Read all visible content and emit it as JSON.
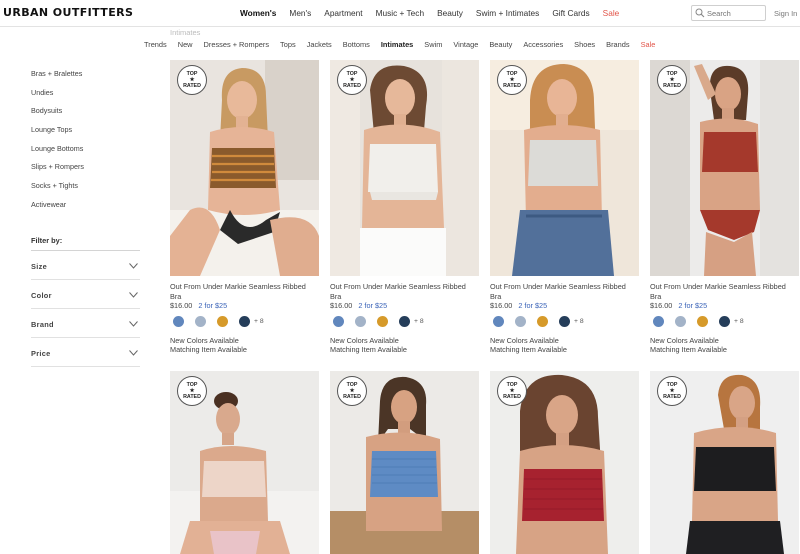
{
  "brand": {
    "logo": "URBAN OUTFITTERS"
  },
  "main_nav": [
    "Women's",
    "Men's",
    "Apartment",
    "Music + Tech",
    "Beauty",
    "Swim + Intimates",
    "Gift Cards",
    "Sale"
  ],
  "search": {
    "placeholder": "Search"
  },
  "account": {
    "signin": "Sign In"
  },
  "breadcrumb_ghost": "Intimates",
  "sub_nav": [
    "Trends",
    "New",
    "Dresses + Rompers",
    "Tops",
    "Jackets",
    "Bottoms",
    "Intimates",
    "Swim",
    "Vintage",
    "Beauty",
    "Accessories",
    "Shoes",
    "Brands",
    "Sale"
  ],
  "sidebar": {
    "categories": [
      "Bras + Bralettes",
      "Undies",
      "Bodysuits",
      "Lounge Tops",
      "Lounge Bottoms",
      "Slips + Rompers",
      "Socks + Tights",
      "Activewear"
    ],
    "filter_heading": "Filter by:",
    "filters": [
      "Size",
      "Color",
      "Brand",
      "Price"
    ]
  },
  "badge": {
    "line1": "TOP",
    "star": "★",
    "line2": "RATED"
  },
  "swatch_colors": [
    "#6187bd",
    "#a3b3c8",
    "#d69a2a",
    "#253e5a"
  ],
  "products": [
    {
      "name": "Out From Under Markie Seamless Ribbed Bra",
      "price": "$16.00",
      "promo": "2 for $25",
      "more_colors": "+ 8",
      "note1": "New Colors Available",
      "note2": "Matching Item Available"
    },
    {
      "name": "Out From Under Markie Seamless Ribbed Bra",
      "price": "$16.00",
      "promo": "2 for $25",
      "more_colors": "+ 8",
      "note1": "New Colors Available",
      "note2": "Matching Item Available"
    },
    {
      "name": "Out From Under Markie Seamless Ribbed Bra",
      "price": "$16.00",
      "promo": "2 for $25",
      "more_colors": "+ 8",
      "note1": "New Colors Available",
      "note2": "Matching Item Available"
    },
    {
      "name": "Out From Under Markie Seamless Ribbed Bra",
      "price": "$16.00",
      "promo": "2 for $25",
      "more_colors": "+ 8",
      "note1": "New Colors Available",
      "note2": "Matching Item Available"
    },
    {
      "name": "",
      "price": "",
      "promo": "",
      "more_colors": "",
      "note1": "",
      "note2": ""
    },
    {
      "name": "",
      "price": "",
      "promo": "",
      "more_colors": "",
      "note1": "",
      "note2": ""
    },
    {
      "name": "",
      "price": "",
      "promo": "",
      "more_colors": "",
      "note1": "",
      "note2": ""
    },
    {
      "name": "",
      "price": "",
      "promo": "",
      "more_colors": "",
      "note1": "",
      "note2": ""
    }
  ]
}
